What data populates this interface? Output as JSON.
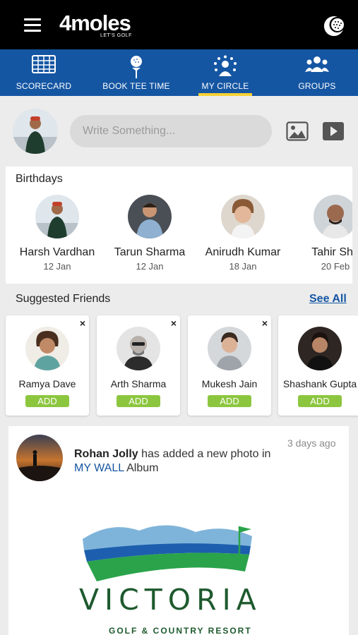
{
  "app": {
    "logo": "4moles",
    "tagline": "LET'S GOLF"
  },
  "nav": {
    "tabs": [
      {
        "label": "SCORECARD",
        "icon": "scorecard-icon"
      },
      {
        "label": "BOOK TEE TIME",
        "icon": "golf-tee-icon"
      },
      {
        "label": "MY CIRCLE",
        "icon": "circle-people-icon",
        "active": true
      },
      {
        "label": "GROUPS",
        "icon": "groups-icon"
      }
    ],
    "active_color": "#f6d033",
    "bar_color": "#1556a3"
  },
  "composer": {
    "placeholder": "Write Something..."
  },
  "birthdays": {
    "title": "Birthdays",
    "people": [
      {
        "name": "Harsh Vardhan",
        "date": "12 Jan"
      },
      {
        "name": "Tarun Sharma",
        "date": "12 Jan"
      },
      {
        "name": "Anirudh Kumar",
        "date": "18 Jan"
      },
      {
        "name": "Tahir Sha",
        "date": "20 Feb"
      }
    ]
  },
  "suggested": {
    "title": "Suggested Friends",
    "see_all": "See All",
    "add_label": "ADD",
    "close_label": "×",
    "add_color": "#8cc63f",
    "people": [
      {
        "name": "Ramya Dave"
      },
      {
        "name": "Arth Sharma"
      },
      {
        "name": "Mukesh Jain"
      },
      {
        "name": "Shashank Gupta"
      }
    ]
  },
  "post": {
    "author": "Rohan Jolly",
    "action": " has added a new photo in",
    "album_link": "MY WALL",
    "album_suffix": " Album",
    "time": "3 days ago",
    "image_title": "VICTORIA",
    "image_subtitle": "GOLF & COUNTRY RESORT"
  }
}
